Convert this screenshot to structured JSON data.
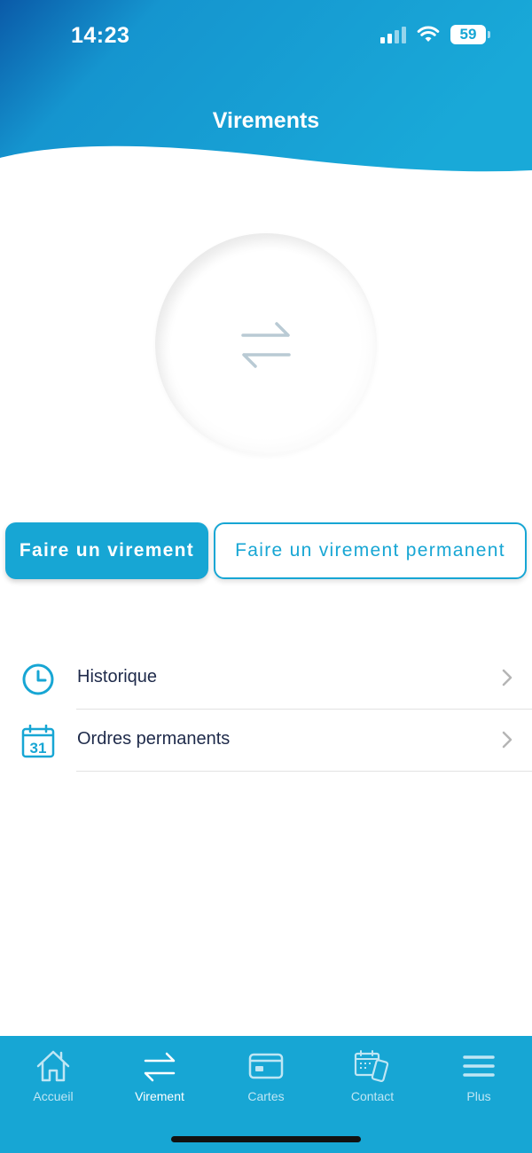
{
  "status_bar": {
    "time": "14:23",
    "battery": "59"
  },
  "header": {
    "title": "Virements"
  },
  "hero": {
    "icon": "transfer-arrows-icon"
  },
  "buttons": {
    "primary": "Faire un virement",
    "secondary": "Faire un virement permanent"
  },
  "menu": {
    "items": [
      {
        "label": "Historique",
        "icon": "clock-icon"
      },
      {
        "label": "Ordres permanents",
        "icon": "calendar-icon",
        "icon_text": "31"
      }
    ]
  },
  "tabbar": {
    "tabs": [
      {
        "label": "Accueil",
        "icon": "home-icon",
        "active": false
      },
      {
        "label": "Virement",
        "icon": "transfer-icon",
        "active": true
      },
      {
        "label": "Cartes",
        "icon": "card-icon",
        "active": false
      },
      {
        "label": "Contact",
        "icon": "contact-icon",
        "active": false
      },
      {
        "label": "Plus",
        "icon": "menu-icon",
        "active": false
      }
    ]
  },
  "colors": {
    "brand": "#17a6d4",
    "brand_dark": "#0b5fa8",
    "text": "#1e2a4a"
  }
}
